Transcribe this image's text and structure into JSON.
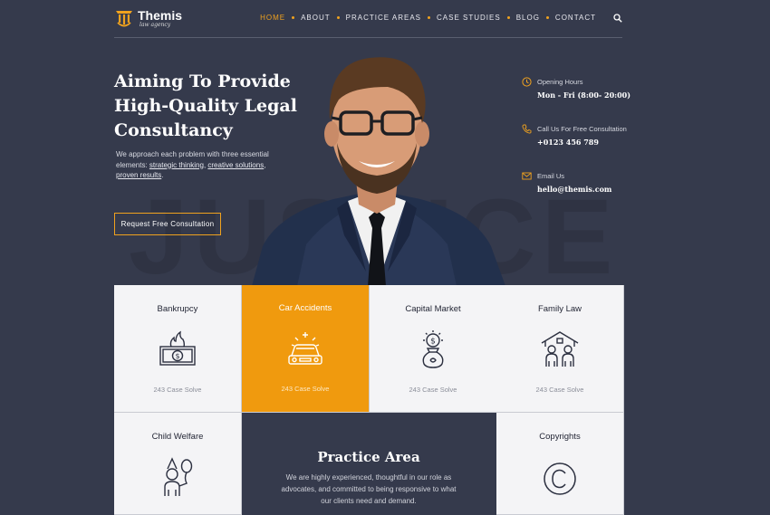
{
  "header": {
    "logo_name": "Themis",
    "logo_tagline": "law agency",
    "nav": [
      {
        "label": "HOME",
        "active": true
      },
      {
        "label": "ABOUT"
      },
      {
        "label": "PRACTICE AREAS"
      },
      {
        "label": "CASE STUDIES"
      },
      {
        "label": "BLOG"
      },
      {
        "label": "CONTACT"
      }
    ],
    "search_icon": "search-icon"
  },
  "hero": {
    "watermark": "JUSTICE",
    "title": "Aiming To Provide High-Quality Legal Consultancy",
    "desc_intro": "We approach each problem with three essential elements: ",
    "desc_link1": "strategic thinking",
    "desc_sep1": ", ",
    "desc_link2": "creative solutions",
    "desc_sep2": ", ",
    "desc_link3": "proven results",
    "desc_end": ".",
    "cta_label": "Request Free Consultation"
  },
  "info": [
    {
      "icon": "clock-icon",
      "label": "Opening Hours",
      "value": "Mon - Fri (8:00- 20:00)"
    },
    {
      "icon": "phone-icon",
      "label": "Call Us For Free Consultation",
      "value": "+0123 456 789"
    },
    {
      "icon": "mail-icon",
      "label": "Email Us",
      "value": "hello@themis.com"
    }
  ],
  "cards": [
    {
      "title": "Bankrupcy",
      "count": "243 Case Solve",
      "icon": "burning-money-icon"
    },
    {
      "title": "Car Accidents",
      "count": "243 Case Solve",
      "icon": "car-crash-icon"
    },
    {
      "title": "Capital Market",
      "count": "243 Case Solve",
      "icon": "money-bag-icon"
    },
    {
      "title": "Family Law",
      "count": "243 Case Solve",
      "icon": "family-house-icon"
    },
    {
      "title": "Child Welfare",
      "icon": "child-balloon-icon"
    },
    {
      "title": "Copyrights",
      "icon": "copyright-icon"
    }
  ],
  "practice_area": {
    "title": "Practice Area",
    "desc": "We are highly experienced, thoughtful in our role as advocates, and committed to being responsive to what our clients need and demand."
  },
  "colors": {
    "accent": "#f0a21e",
    "background": "#353a4c",
    "card": "#f4f4f6",
    "highlight": "#f09a0e"
  }
}
